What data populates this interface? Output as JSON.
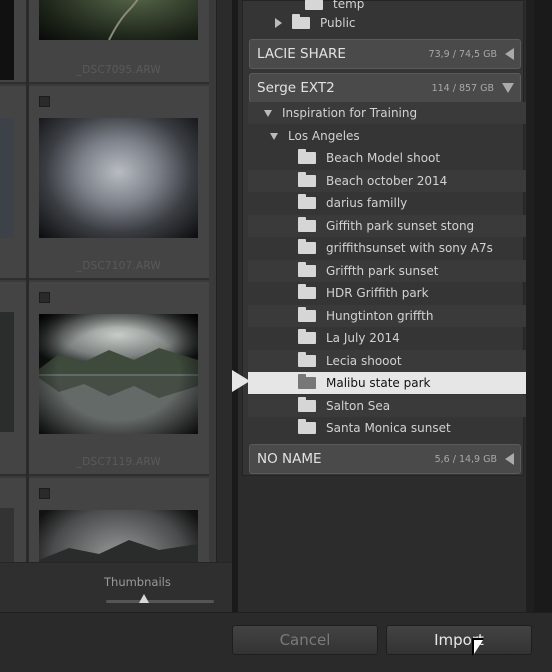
{
  "grid": {
    "cells": [
      {
        "filename": "_DSC7095.ARW",
        "has_checkbox": false
      },
      {
        "filename": "_DSC7107.ARW",
        "has_checkbox": true
      },
      {
        "filename": "_DSC7119.ARW",
        "has_checkbox": true
      },
      {
        "filename": "",
        "has_checkbox": true
      }
    ]
  },
  "thumbnails": {
    "label": "Thumbnails",
    "level": 0.35
  },
  "panel": {
    "top_items": [
      {
        "label": "temp"
      },
      {
        "label": "Public"
      }
    ],
    "volumes": [
      {
        "name": "LACIE SHARE",
        "size": "73,9 / 74,5 GB"
      },
      {
        "name": "Serge EXT2",
        "size": "114 / 857 GB"
      },
      {
        "name": "NO NAME",
        "size": "5,6 / 14,9 GB"
      }
    ],
    "tree": [
      {
        "label": "Inspiration for Training"
      },
      {
        "label": "Los Angeles"
      }
    ],
    "folders": [
      {
        "label": "Beach Model shoot"
      },
      {
        "label": "Beach october 2014"
      },
      {
        "label": "darius familly"
      },
      {
        "label": "Giffith park sunset stong"
      },
      {
        "label": "griffithsunset with sony A7s"
      },
      {
        "label": "Griffth park sunset"
      },
      {
        "label": "HDR Griffith park"
      },
      {
        "label": "Hungtinton griffth"
      },
      {
        "label": "La July 2014"
      },
      {
        "label": "Lecia shooot"
      },
      {
        "label": "Malibu state park",
        "selected": true
      },
      {
        "label": "Salton Sea"
      },
      {
        "label": "Santa Monica sunset"
      }
    ]
  },
  "footer": {
    "cancel_label": "Cancel",
    "import_label": "Import"
  },
  "icons": {
    "folder": "folder-icon",
    "disclosure": "disclosure-triangle-icon",
    "cursor": "mouse-pointer-icon"
  }
}
